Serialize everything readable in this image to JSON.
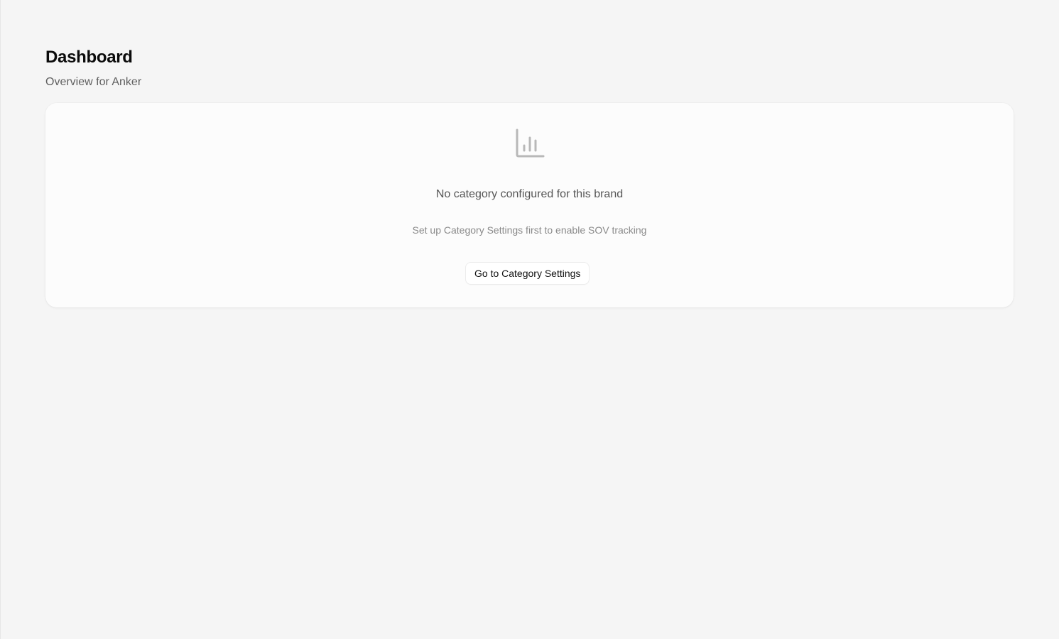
{
  "header": {
    "title": "Dashboard",
    "subtitle": "Overview for Anker"
  },
  "empty_state": {
    "icon": "bar-chart-icon",
    "title": "No category configured for this brand",
    "description": "Set up Category Settings first to enable SOV tracking",
    "button_label": "Go to Category Settings"
  },
  "colors": {
    "background": "#f5f5f5",
    "card": "#fcfcfc",
    "icon": "#b8b8b8",
    "title": "#0b0b0b",
    "muted_text": "#555555"
  }
}
